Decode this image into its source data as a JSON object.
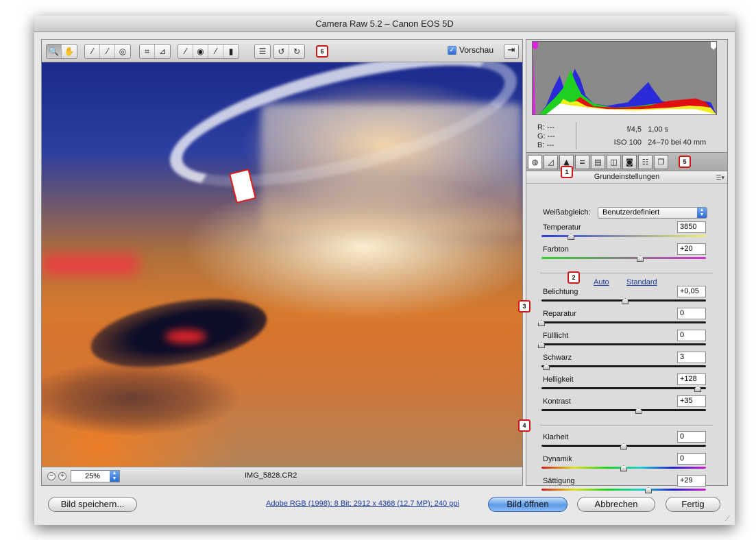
{
  "window": {
    "title": "Camera Raw 5.2 – Canon EOS 5D"
  },
  "toolbar": {
    "callout": "6",
    "tools": [
      {
        "icon": "zoom-icon",
        "glyph": "🔍"
      },
      {
        "icon": "hand-icon",
        "glyph": "✋"
      },
      {
        "icon": "white-balance-eyedropper-icon",
        "glyph": "⁄"
      },
      {
        "icon": "color-sampler-icon",
        "glyph": "⁄"
      },
      {
        "icon": "target-adjustment-icon",
        "glyph": "◎"
      },
      {
        "icon": "crop-icon",
        "glyph": "⌗"
      },
      {
        "icon": "straighten-icon",
        "glyph": "⊿"
      },
      {
        "icon": "spot-removal-icon",
        "glyph": "⁄"
      },
      {
        "icon": "red-eye-icon",
        "glyph": "◉"
      },
      {
        "icon": "adjustment-brush-icon",
        "glyph": "⁄"
      },
      {
        "icon": "graduated-filter-icon",
        "glyph": "▮"
      },
      {
        "icon": "preferences-icon",
        "glyph": "☰"
      },
      {
        "icon": "rotate-left-icon",
        "glyph": "↺"
      },
      {
        "icon": "rotate-right-icon",
        "glyph": "↻"
      }
    ],
    "preview_label": "Vorschau",
    "fullscreen_glyph": "⇥"
  },
  "status": {
    "zoom_minus": "−",
    "zoom_plus": "+",
    "zoom_value": "25%",
    "filename": "IMG_5828.CR2"
  },
  "readout": {
    "r": "R:  ---",
    "g": "G:  ---",
    "b": "B:  ---",
    "aperture": "f/4,5",
    "shutter": "1,00 s",
    "iso": "ISO 100",
    "lens": "24–70 bei 40 mm"
  },
  "panel_tabs": {
    "callout": "5",
    "tabs": [
      {
        "icon": "basic-icon",
        "glyph": "◍"
      },
      {
        "icon": "tone-curve-icon",
        "glyph": "◿"
      },
      {
        "icon": "detail-icon",
        "glyph": "▲"
      },
      {
        "icon": "hsl-icon",
        "glyph": "≡"
      },
      {
        "icon": "split-toning-icon",
        "glyph": "▤"
      },
      {
        "icon": "lens-corrections-icon",
        "glyph": "◫"
      },
      {
        "icon": "camera-calibration-icon",
        "glyph": "◙"
      },
      {
        "icon": "presets-icon",
        "glyph": "☷"
      },
      {
        "icon": "snapshots-icon",
        "glyph": "❐"
      }
    ]
  },
  "section": {
    "title": "Grundeinstellungen",
    "callout": "1",
    "menu_glyph": "☰▾"
  },
  "settings": {
    "white_balance": {
      "label": "Weißabgleich:",
      "value": "Benutzerdefiniert"
    },
    "callout_2": "2",
    "callout_3": "3",
    "callout_4": "4",
    "auto_label": "Auto",
    "standard_label": "Standard",
    "sliders": [
      {
        "label": "Temperatur",
        "value": "3850",
        "level": 0.18
      },
      {
        "label": "Farbton",
        "value": "+20",
        "level": 0.6
      },
      {
        "label": "Belichtung",
        "value": "+0,05",
        "level": 0.51
      },
      {
        "label": "Reparatur",
        "value": "0",
        "level": 0.0
      },
      {
        "label": "Fülllicht",
        "value": "0",
        "level": 0.0
      },
      {
        "label": "Schwarz",
        "value": "3",
        "level": 0.03
      },
      {
        "label": "Helligkeit",
        "value": "+128",
        "level": 0.95
      },
      {
        "label": "Kontrast",
        "value": "+35",
        "level": 0.59
      },
      {
        "label": "Klarheit",
        "value": "0",
        "level": 0.5
      },
      {
        "label": "Dynamik",
        "value": "0",
        "level": 0.5
      },
      {
        "label": "Sättigung",
        "value": "+29",
        "level": 0.65
      }
    ]
  },
  "buttons": {
    "save": "Bild speichern...",
    "info": "Adobe RGB (1998); 8 Bit; 2912 x 4368 (12,7 MP); 240 ppi",
    "open": "Bild öffnen",
    "cancel": "Abbrechen",
    "done": "Fertig"
  }
}
